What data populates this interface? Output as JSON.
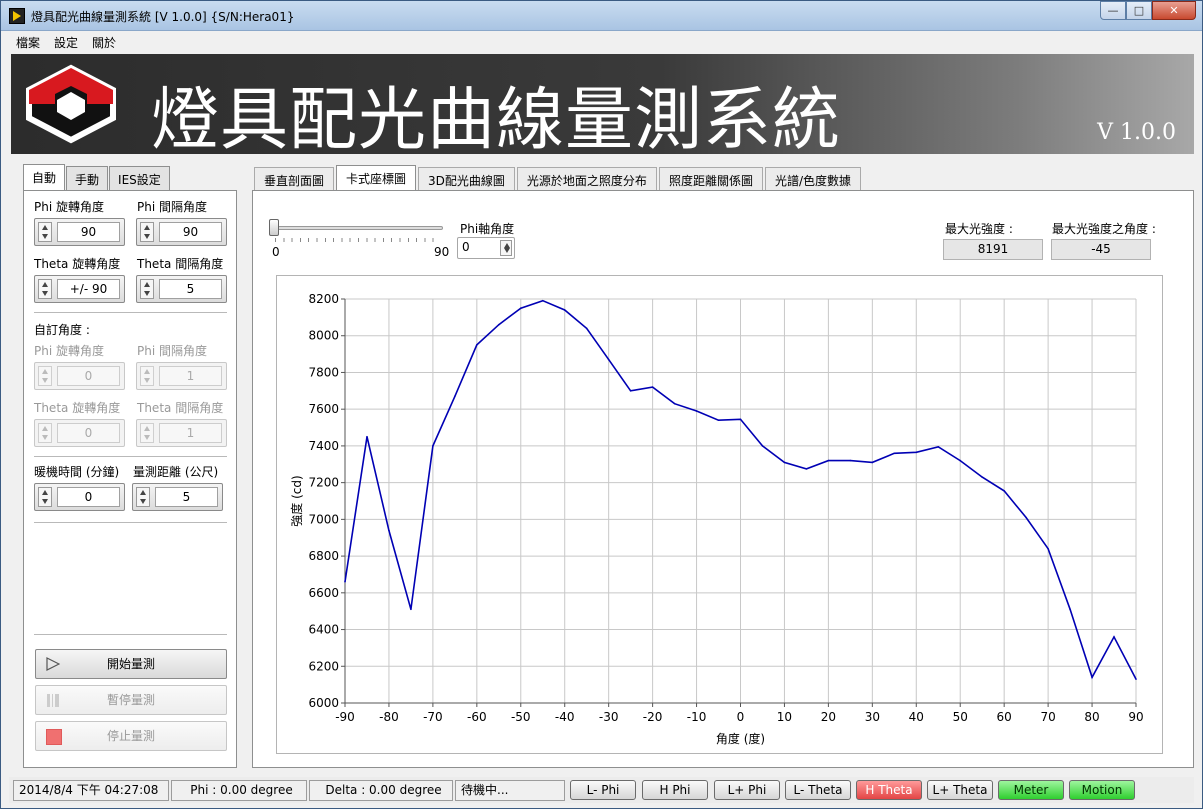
{
  "window": {
    "title": "燈具配光曲線量測系統 [V 1.0.0] {S/N:Hera01}"
  },
  "menu": [
    "檔案",
    "設定",
    "關於"
  ],
  "banner": {
    "title": "燈具配光曲線量測系統",
    "version": "V 1.0.0"
  },
  "left": {
    "tabs": [
      "自動",
      "手動",
      "IES設定"
    ],
    "phi_rot_label": "Phi 旋轉角度",
    "phi_rot_value": "90",
    "phi_int_label": "Phi 間隔角度",
    "phi_int_value": "90",
    "theta_rot_label": "Theta 旋轉角度",
    "theta_rot_value": "+/- 90",
    "theta_int_label": "Theta 間隔角度",
    "theta_int_value": "5",
    "custom_label": "自訂角度 :",
    "c_phi_rot_label": "Phi 旋轉角度",
    "c_phi_rot_value": "0",
    "c_phi_int_label": "Phi 間隔角度",
    "c_phi_int_value": "1",
    "c_theta_rot_label": "Theta 旋轉角度",
    "c_theta_rot_value": "0",
    "c_theta_int_label": "Theta 間隔角度",
    "c_theta_int_value": "1",
    "warmup_label": "暖機時間 (分鐘)",
    "warmup_value": "0",
    "distance_label": "量測距離 (公尺)",
    "distance_value": "5",
    "start_label": "開始量測",
    "pause_label": "暫停量測",
    "stop_label": "停止量測"
  },
  "right": {
    "tabs": [
      "垂直剖面圖",
      "卡式座標圖",
      "3D配光曲線圖",
      "光源於地面之照度分布",
      "照度距離關係圖",
      "光譜/色度數據"
    ],
    "slider_min": "0",
    "slider_max": "90",
    "phi_axis_label": "Phi軸角度",
    "phi_axis_value": "0",
    "max_intensity_label": "最大光強度 :",
    "max_intensity_value": "8191",
    "max_angle_label": "最大光強度之角度 :",
    "max_angle_value": "-45"
  },
  "chart_data": {
    "type": "line",
    "xlabel": "角度 (度)",
    "ylabel": "強度 (cd)",
    "xlim": [
      -90,
      90
    ],
    "ylim": [
      6000,
      8200
    ],
    "xticks": [
      -90,
      -80,
      -70,
      -60,
      -50,
      -40,
      -30,
      -20,
      -10,
      0,
      10,
      20,
      30,
      40,
      50,
      60,
      70,
      80,
      90
    ],
    "yticks": [
      6000,
      6200,
      6400,
      6600,
      6800,
      7000,
      7200,
      7400,
      7600,
      7800,
      8000,
      8200
    ],
    "grid": true,
    "color": "#0000b4",
    "x": [
      -90,
      -85,
      -80,
      -75,
      -70,
      -65,
      -60,
      -55,
      -50,
      -45,
      -40,
      -35,
      -30,
      -25,
      -20,
      -15,
      -10,
      -5,
      0,
      5,
      10,
      15,
      20,
      25,
      30,
      35,
      40,
      45,
      50,
      55,
      60,
      65,
      70,
      75,
      80,
      85,
      90
    ],
    "y": [
      6660,
      7450,
      6940,
      6510,
      7400,
      7670,
      7950,
      8060,
      8150,
      8191,
      8140,
      8040,
      7870,
      7700,
      7720,
      7630,
      7590,
      7540,
      7545,
      7400,
      7310,
      7275,
      7320,
      7320,
      7310,
      7360,
      7365,
      7395,
      7320,
      7230,
      7155,
      7010,
      6840,
      6510,
      6140,
      6360,
      6130
    ]
  },
  "status": {
    "datetime": "2014/8/4 下午 04:27:08",
    "phi": "Phi : 0.00 degree",
    "delta": "Delta : 0.00 degree",
    "state": "待機中...",
    "indicators": [
      "L- Phi",
      "H Phi",
      "L+ Phi",
      "L- Theta",
      "H Theta",
      "L+ Theta",
      "Meter",
      "Motion"
    ]
  }
}
